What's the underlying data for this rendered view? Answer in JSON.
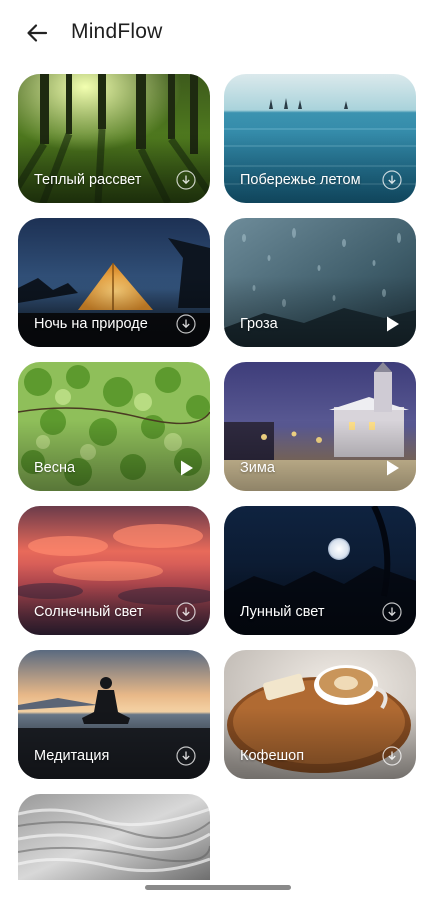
{
  "header": {
    "back_icon": "arrow-left-icon",
    "title": "MindFlow"
  },
  "sounds": [
    {
      "label": "Теплый рассвет",
      "action": "download"
    },
    {
      "label": "Побережье летом",
      "action": "download"
    },
    {
      "label": "Ночь на природе",
      "action": "download"
    },
    {
      "label": "Гроза",
      "action": "play"
    },
    {
      "label": "Весна",
      "action": "play"
    },
    {
      "label": "Зима",
      "action": "play"
    },
    {
      "label": "Солнечный свет",
      "action": "download"
    },
    {
      "label": "Лунный свет",
      "action": "download"
    },
    {
      "label": "Медитация",
      "action": "download"
    },
    {
      "label": "Кофешоп",
      "action": "download"
    },
    {
      "label": "",
      "action": ""
    }
  ]
}
